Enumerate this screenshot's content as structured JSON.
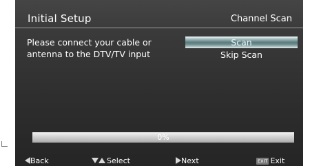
{
  "header": {
    "title": "Initial Setup",
    "breadcrumb": "Channel Scan"
  },
  "message": "Please connect your cable or antenna to the DTV/TV input",
  "menu": {
    "items": [
      {
        "label": "Scan",
        "selected": true
      },
      {
        "label": "Skip Scan",
        "selected": false
      }
    ]
  },
  "progress": {
    "percent": 0,
    "label": "0%"
  },
  "footer": {
    "back_label": "Back",
    "back_icon": "left-arrow-icon",
    "select_label": "Select",
    "select_icon": "up-down-arrow-icon",
    "next_label": "Next",
    "next_icon": "right-arrow-icon",
    "exit_key": "EXIT",
    "exit_label": "Exit"
  },
  "colors": {
    "background": "#2f2f2f",
    "highlight": "#5a7a7c",
    "text": "#ffffff"
  }
}
